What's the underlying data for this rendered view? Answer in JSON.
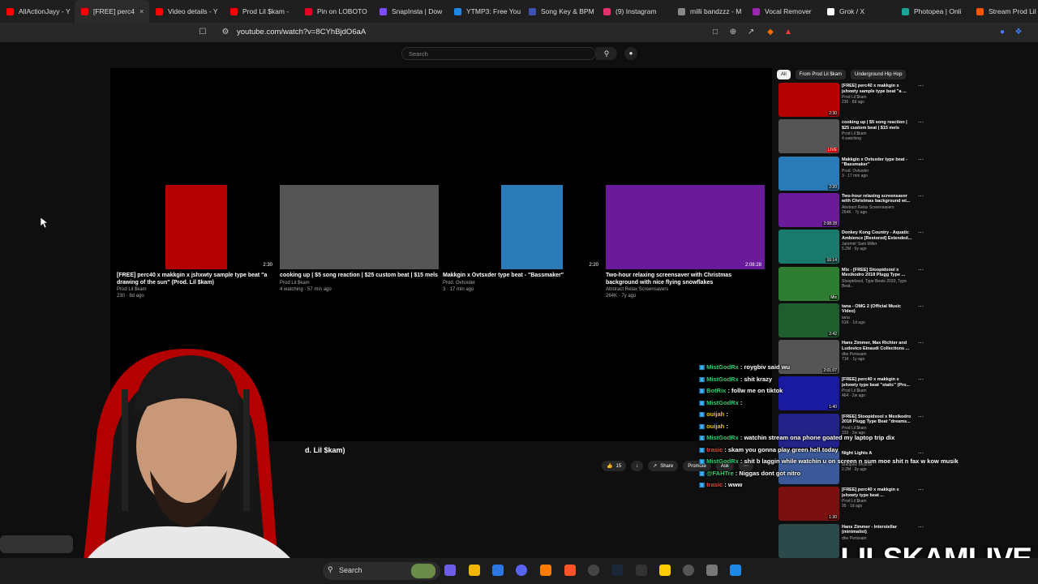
{
  "browser": {
    "tabs": [
      {
        "label": "AllActionJayy - Y",
        "color": "#ff0000"
      },
      {
        "label": "[FREE] perc4",
        "color": "#ff0000",
        "active": true
      },
      {
        "label": "Video details - Y",
        "color": "#ff0000"
      },
      {
        "label": "Prod Lil $kam -",
        "color": "#ff0000"
      },
      {
        "label": "Pin on LOBOTO",
        "color": "#e60023"
      },
      {
        "label": "SnapInsta | Dow",
        "color": "#7c4dff"
      },
      {
        "label": "YTMP3: Free You",
        "color": "#1e88e5"
      },
      {
        "label": "Song Key & BPM",
        "color": "#3f51b5"
      },
      {
        "label": "(9) Instagram",
        "color": "#e1306c"
      },
      {
        "label": "milli bandzzz - M",
        "color": "#888888"
      },
      {
        "label": "Vocal Remover",
        "color": "#9c27b0"
      },
      {
        "label": "Grok / X",
        "color": "#ffffff"
      },
      {
        "label": "Photopea | Onli",
        "color": "#18a497"
      },
      {
        "label": "Stream Prod Lil $",
        "color": "#ff5500"
      }
    ],
    "url": "youtube.com/watch?v=8CYhBjdO6aA"
  },
  "youtube": {
    "search_placeholder": "Search",
    "video_title_partial": "d. Lil $kam)",
    "like_count": "15",
    "share_label": "Share",
    "promote_label": "Promote",
    "ask_label": "Ask",
    "end_cards": [
      {
        "title": "[FREE] perc40 x makkgin x jshxwty sample type beat \"a drawing of the sun\" (Prod. Lil $kam)",
        "channel": "Prod Lil $kam",
        "meta": "230 · 8d ago",
        "duration": "2:30",
        "color": "#b30000"
      },
      {
        "title": "cooking up | $5 song reaction | $25 custom beat | $15 mels",
        "channel": "Prod Lil $kam",
        "meta": "4 watching · 57 min ago",
        "duration": "",
        "color": "#555555"
      },
      {
        "title": "Makkgin x Ovtsxder type beat - \"Bassmaker\"",
        "channel": "Prod. Ovtsxder",
        "meta": "3 · 17 min ago",
        "duration": "2:20",
        "color": "#2a7ab8"
      },
      {
        "title": "Two-hour relaxing screensaver with Christmas background with nice flying snowflakes",
        "channel": "Abstract Relax Screensavers",
        "meta": "264K · 7y ago",
        "duration": "2:08:28",
        "color": "#6a1b9a"
      }
    ],
    "chips": [
      "All",
      "From Prod Lil $kam",
      "Underground Hip Hop"
    ],
    "sidebar": [
      {
        "title": "[FREE] perc40 x makkgin x jshxwty sample type beat \"a ...",
        "channel": "Prod Lil $kam",
        "meta": "230 · 8d ago",
        "duration": "2:30",
        "color": "#b30000"
      },
      {
        "title": "cooking up | $5 song reaction | $25 custom beat | $15 mels",
        "channel": "Prod Lil $kam",
        "meta": "4 watching",
        "duration": "LIVE",
        "color": "#555555"
      },
      {
        "title": "Makkgin x Ovtsxder type beat - \"Bassmaker\"",
        "channel": "Prod. Ovtsxder",
        "meta": "3 · 17 min ago",
        "duration": "2:20",
        "color": "#2a7ab8"
      },
      {
        "title": "Two-hour relaxing screensaver with Christmas background wi...",
        "channel": "Abstract Relax Screensavers",
        "meta": "264K · 7y ago",
        "duration": "2:08:28",
        "color": "#6a1b9a"
      },
      {
        "title": "Donkey Kong Country - Aquatic Ambience [Restored] Extended...",
        "channel": "Jammin' Sam Miller",
        "meta": "5.2M · 5y ago",
        "duration": "16:14",
        "color": "#1b7a6e"
      },
      {
        "title": "Mix - [FREE] Stoopidxool x Mexikodro 2018 Plugg Type ...",
        "channel": "Stoopidxool, Type Beats 2020, Type Beat...",
        "meta": "",
        "duration": "Mix",
        "color": "#2e7d32"
      },
      {
        "title": "tana - OMG 2 (Official Music Video)",
        "channel": "tana",
        "meta": "61K · 1d ago",
        "duration": "2:42",
        "color": "#1f5c2e"
      },
      {
        "title": "Hans Zimmer, Max Richter and Ludovico Einaudi Collections ...",
        "channel": "dhe Perissam",
        "meta": "71K · 1y ago",
        "duration": "2:01:07",
        "color": "#555555"
      },
      {
        "title": "[FREE] perc40 x makkgin x jshxwty type beat \"static\" (Pro...",
        "channel": "Prod Lil $kam",
        "meta": "464 · 2w ago",
        "duration": "1:40",
        "color": "#1a1aa0"
      },
      {
        "title": "[FREE] Stoopidxool x Mexikodro 2018 Plugg Type Beat \"dreams...",
        "channel": "Prod Lil $kam",
        "meta": "333 · 2w ago",
        "duration": "",
        "color": "#222288"
      },
      {
        "title": "Night Lights A",
        "channel": "aranjuez records",
        "meta": "2.2M · 3y ago",
        "duration": "",
        "color": "#3b5998"
      },
      {
        "title": "[FREE] perc40 x makkgin x jshxwty type beat ...",
        "channel": "Prod Lil $kam",
        "meta": "95 · 1d ago",
        "duration": "1:30",
        "color": "#7a1010"
      },
      {
        "title": "Hans Zimmer - Interstellar (minimalist)",
        "channel": "dhe Perissam",
        "meta": "",
        "duration": "",
        "color": "#2c4a4a"
      }
    ]
  },
  "chat": [
    {
      "user": "MistGodRx",
      "text": ": roygbiv said wu",
      "userColor": "#2ecc71"
    },
    {
      "user": "MistGodRx",
      "text": ": shit krazy",
      "userColor": "#2ecc71"
    },
    {
      "user": "BotRix",
      "text": ": follw me on tiktok",
      "userColor": "#2ecc71"
    },
    {
      "user": "MistGodRx",
      "text": ":",
      "userColor": "#2ecc71"
    },
    {
      "user": "ouijah",
      "text": ":",
      "userColor": "#f1c40f"
    },
    {
      "user": "ouijah",
      "text": ":",
      "userColor": "#f1c40f"
    },
    {
      "user": "MistGodRx",
      "text": ": watchin stream ona phone goated my laptop trip dix",
      "userColor": "#2ecc71"
    },
    {
      "user": "trasic",
      "text": ": skam you gonna play green hell today",
      "userColor": "#e74c3c"
    },
    {
      "user": "MistGodRx",
      "text": ": shit b laggin while watchin u on screen n sum moe shit n fax w kow musik",
      "userColor": "#2ecc71"
    },
    {
      "user": "@FAHTre",
      "text": ": Niggas dont got nitro",
      "userColor": "#2ecc71"
    },
    {
      "user": "trasic",
      "text": ": www",
      "userColor": "#e74c3c"
    }
  ],
  "overlay": {
    "watermark": "LILSKAMLIVE"
  },
  "taskbar": {
    "search_label": "Search"
  }
}
